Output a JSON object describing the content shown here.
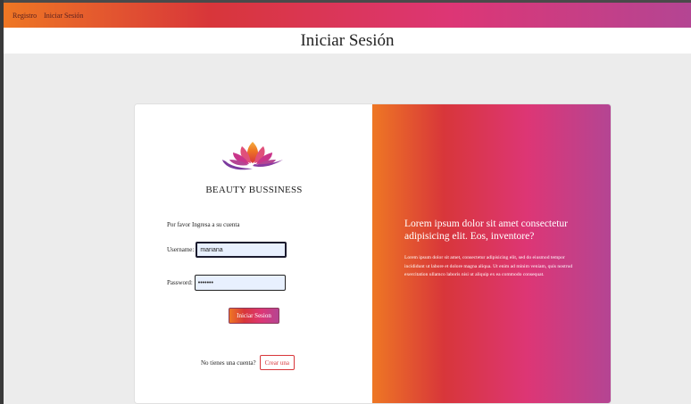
{
  "nav": {
    "links": [
      "Registro",
      "Iniciar Sesión"
    ]
  },
  "page": {
    "title": "Iniciar Sesión"
  },
  "login": {
    "logo_icon": "lotus-icon",
    "brand": "BEAUTY BUSSINESS",
    "prompt": "Por favor Ingresa a su cuenta",
    "username_label": "Username:",
    "username_value": "mariana",
    "password_label": "Password:",
    "password_value": "•••••••",
    "submit_label": "Iniciar Sesion",
    "signup_text": "No tienes una cuenta?",
    "signup_label": "Crear una"
  },
  "hero": {
    "title": "Lorem ipsum dolor sit amet consectetur adipisicing elit. Eos, inventore?",
    "body": "Lorem ipsum dolor sit amet, consectetur adipisicing elit, sed do eiusmod tempor incididunt ut labore et dolore magna aliqua. Ut enim ad minim veniam, quis nostrud exercitation ullamco laboris nisi ut aliquip ex ea commodo consequat."
  },
  "colors": {
    "gradient": [
      "#ee7724",
      "#d8363a",
      "#dd3675",
      "#b44593"
    ],
    "background": "#ececec",
    "input_fill": "#e8f0fe"
  }
}
